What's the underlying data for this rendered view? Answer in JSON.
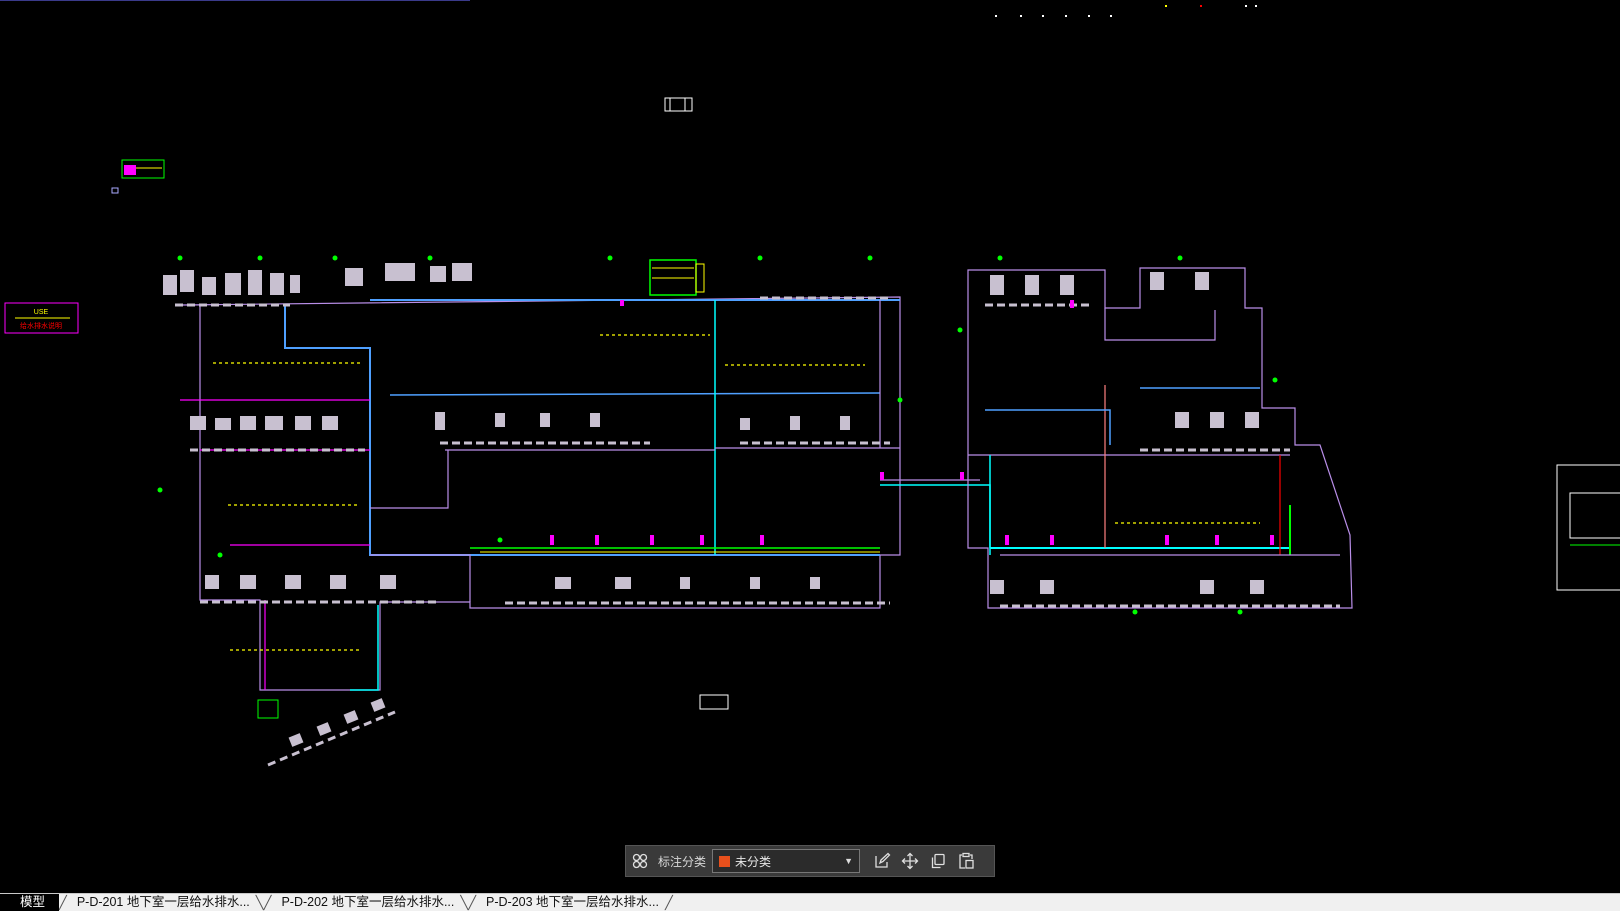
{
  "drawing": {
    "left_legend_text_top": "USE",
    "left_legend_text_bottom": "给水排水说明"
  },
  "annotation_toolbar": {
    "grid_icon": "grid-four-icon",
    "label": "标注分类",
    "category_value": "未分类",
    "category_color": "#e8501c",
    "tools": [
      "edit-icon",
      "move-icon",
      "copy-icon",
      "paste-icon"
    ]
  },
  "layout_tabs": [
    {
      "label": "模型",
      "active": true
    },
    {
      "label": "P-D-201 地下室一层给水排水...",
      "active": false
    },
    {
      "label": "P-D-202 地下室一层给水排水...",
      "active": false
    },
    {
      "label": "P-D-203 地下室一层给水排水...",
      "active": false
    }
  ],
  "colors": {
    "background": "#000000",
    "magenta": "#ff00ff",
    "green": "#00ff00",
    "yellow": "#ffff00",
    "cyan": "#00ffff",
    "violet": "#b98ee8",
    "red": "#ff0000",
    "white": "#ffffff"
  }
}
